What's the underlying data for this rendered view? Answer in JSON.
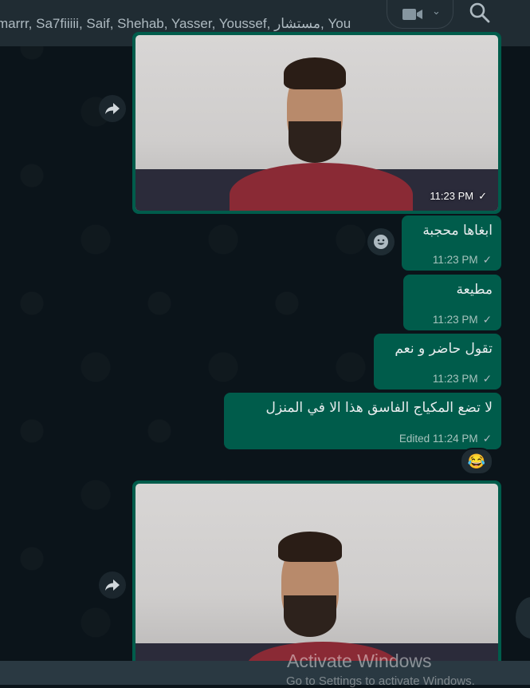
{
  "header": {
    "participants": "marrr, Sa7fiiiii, Saif, Shehab, Yasser, Youssef, مستشار, You",
    "video_icon": "video-camera-icon",
    "search_icon": "search-icon"
  },
  "messages": [
    {
      "type": "image",
      "time": "11:23 PM",
      "status": "sent"
    },
    {
      "type": "text",
      "text": "ابغاها محجبة",
      "time": "11:23 PM",
      "status": "sent"
    },
    {
      "type": "text",
      "text": "مطيعة",
      "time": "11:23 PM",
      "status": "sent"
    },
    {
      "type": "text",
      "text": "تقول حاضر و نعم",
      "time": "11:23 PM",
      "status": "sent"
    },
    {
      "type": "text",
      "text": "لا تضع المكياج الفاسق هذا  الا في المنزل",
      "edited_label": "Edited",
      "time": "11:24 PM",
      "status": "sent",
      "reaction": "😂"
    },
    {
      "type": "image",
      "time": "",
      "status": "sent"
    }
  ],
  "watermark": {
    "title": "Activate Windows",
    "subtitle": "Go to Settings to activate Windows."
  },
  "colors": {
    "outgoing_bubble": "#005c4b",
    "chat_background": "#0b141a",
    "header": "#202c33"
  }
}
